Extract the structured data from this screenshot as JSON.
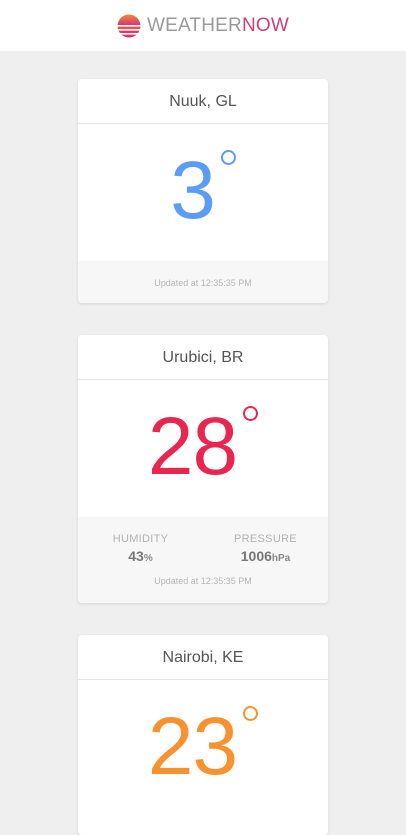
{
  "header": {
    "logo_icon": "sunset-icon",
    "brand_part1": "WEATHER",
    "brand_part2": "NOW",
    "brand_color_1": "#9a9a9a",
    "brand_color_2": "#cc3f7a"
  },
  "cards": [
    {
      "city": "Nuuk, GL",
      "temperature": "3",
      "temp_color": "#5b9cf7",
      "updated": "Updated at 12:35:35 PM"
    },
    {
      "city": "Urubici, BR",
      "temperature": "28",
      "temp_color": "#e8264f",
      "humidity_label": "HUMIDITY",
      "humidity_value": "43",
      "humidity_unit": "%",
      "pressure_label": "PRESSURE",
      "pressure_value": "1006",
      "pressure_unit": "hPa",
      "updated": "Updated at 12:35:35 PM"
    },
    {
      "city": "Nairobi, KE",
      "temperature": "23",
      "temp_color": "#f7922f"
    }
  ]
}
